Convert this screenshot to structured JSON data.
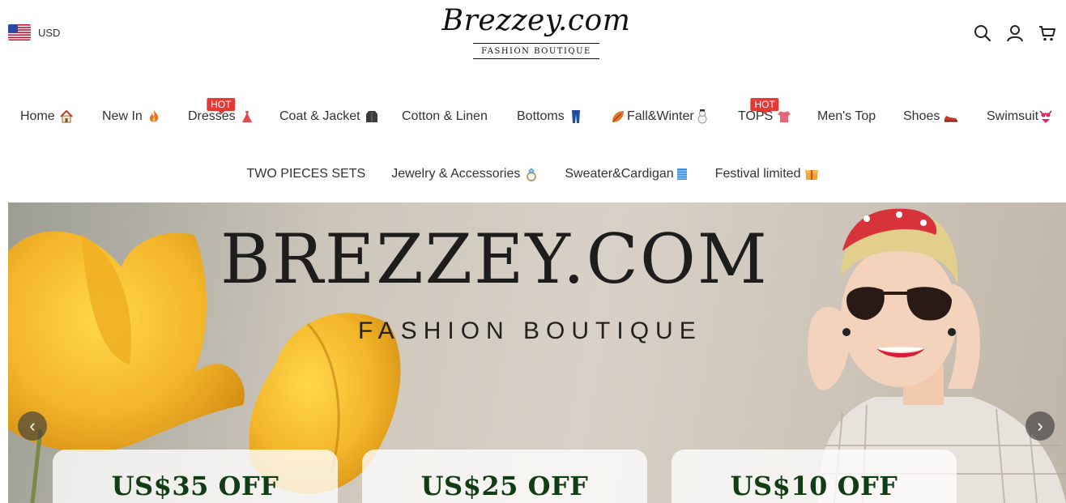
{
  "header": {
    "currency": "USD",
    "logo_text": "Brezzey.com",
    "logo_tagline": "FASHION BOUTIQUE",
    "icons": [
      "search-icon",
      "account-icon",
      "cart-icon"
    ]
  },
  "nav": {
    "row1": [
      {
        "label": "Home",
        "icon": "house-icon"
      },
      {
        "label": "New In",
        "icon": "fire-icon"
      },
      {
        "label": "Dresses",
        "icon": "dress-icon",
        "badge": "HOT"
      },
      {
        "label": "Coat & Jacket",
        "icon": "coat-icon"
      },
      {
        "label": "Cotton & Linen"
      },
      {
        "label": "Bottoms",
        "icon": "jeans-icon"
      },
      {
        "label": "Fall&Winter",
        "icon": "leaf-snowman-icon"
      },
      {
        "label": "TOPS",
        "icon": "shirt-icon",
        "badge": "HOT"
      },
      {
        "label": "Men's Top"
      },
      {
        "label": "Shoes",
        "icon": "shoe-icon"
      },
      {
        "label": "Swimsuit",
        "icon": "bikini-icon"
      }
    ],
    "row2": [
      {
        "label": "TWO PIECES SETS"
      },
      {
        "label": "Jewelry & Accessories",
        "icon": "ring-icon"
      },
      {
        "label": "Sweater&Cardigan",
        "icon": "scarf-icon"
      },
      {
        "label": "Festival limited",
        "icon": "gift-icon"
      }
    ]
  },
  "banner": {
    "title": "BREZZEY.COM",
    "subtitle": "FASHION BOUTIQUE",
    "coupons": [
      "US$35 OFF",
      "US$25 OFF",
      "US$10 OFF"
    ]
  },
  "colors": {
    "hot_badge": "#e53935",
    "coupon_text": "#113d15"
  }
}
